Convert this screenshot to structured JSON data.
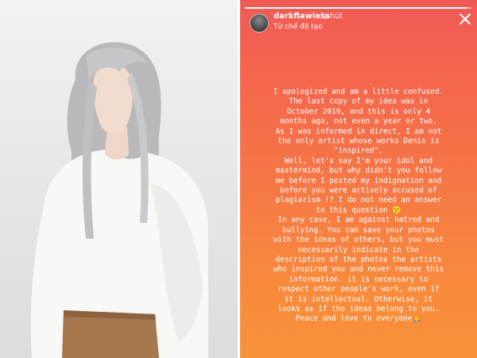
{
  "story": {
    "username": "darkflawless",
    "time": "3phút",
    "mode": "Từ chế độ tạo",
    "progress": 0.98,
    "close_icon": "close-icon",
    "caption_lines": [
      "I apologized and am a little confused.",
      "The last copy of my idea was in",
      "October 2019, and this is only 4",
      "months ago, not even a year or two.",
      "As I was informed in direct, I am not",
      "the only artist whose works Denis is",
      "\"inspired\".",
      "Well, let's say I'm your idol and",
      "mastermind, but why didn't you follow",
      "me before I posted my indignation and",
      "before you were actively accused of",
      "plagiarism !? I do not need an answer",
      "to this question 😕",
      "In any case, I am against hatred and",
      "bullying. You can save your photos",
      "with the ideas of others, but you must",
      "necessarily indicate in the",
      "description of the photos the artists",
      "who inspired you and never remove this",
      "information. it is necessary to",
      "respect other people's work, even if",
      "it is intellectual. Otherwise, it",
      "looks as if the ideas belong to you.",
      "Peace and love to everyone🙏"
    ]
  },
  "colors": {
    "story_top": "#f05a55",
    "story_bottom": "#f7923a",
    "photo_bg": "#ececec"
  }
}
